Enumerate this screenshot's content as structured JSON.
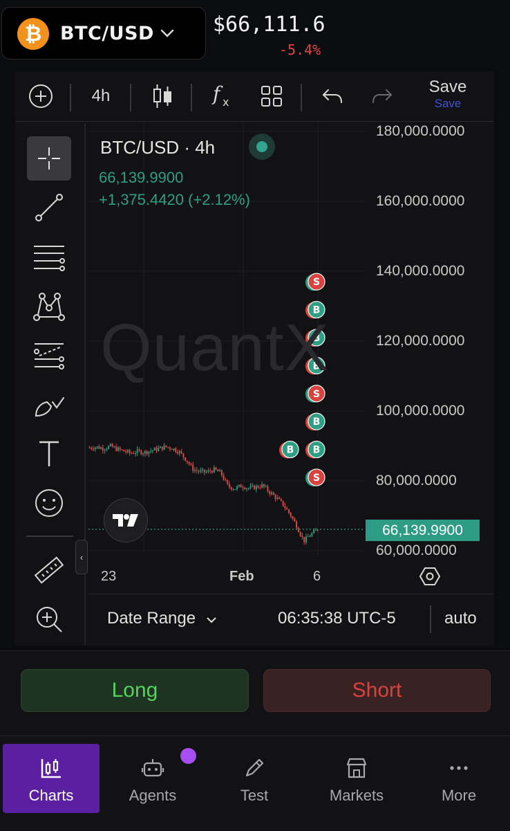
{
  "header": {
    "pair_icon": "bitcoin-icon",
    "pair": "BTC/USD",
    "price": "$66,111.6",
    "change": "-5.4%",
    "colors": {
      "positive": "#2f9f84",
      "negative": "#e04848",
      "btc": "#f2921b"
    }
  },
  "toolbar": {
    "add_icon": "plus-circle-icon",
    "interval": "4h",
    "candles_icon": "candlestick-icon",
    "indicators_icon": "fx-icon",
    "layouts_icon": "grid-icon",
    "undo_icon": "undo-icon",
    "redo_icon": "redo-icon",
    "save_label": "Save",
    "save_sub": "Save"
  },
  "drawing_tools": [
    "crosshair-icon",
    "trend-line-icon",
    "horizontal-lines-icon",
    "pattern-icon",
    "fib-icon",
    "brush-icon",
    "text-icon",
    "emoji-icon",
    "ruler-icon",
    "zoom-in-icon"
  ],
  "legend": {
    "title": "BTC/USD · 4h",
    "value": "66,139.9900",
    "change": "+1,375.4420 (+2.12%)"
  },
  "watermark": "QuantX",
  "chart_data": {
    "type": "candlestick",
    "y_ticks": [
      "180,000.0000",
      "160,000.0000",
      "140,000.0000",
      "120,000.0000",
      "100,000.0000",
      "80,000.0000",
      "60,000.0000"
    ],
    "x_ticks": [
      "23",
      "Feb",
      "6"
    ],
    "ylim": [
      60000,
      180000
    ],
    "last_price_label": "66,139.9900",
    "last_price": 66139.99,
    "trend_close": [
      89500,
      89700,
      89300,
      89900,
      89100,
      88500,
      87900,
      88400,
      88200,
      88700,
      89200,
      89800,
      89300,
      88300,
      86000,
      83300,
      82600,
      82500,
      83200,
      82300,
      78500,
      77800,
      78600,
      77900,
      78200,
      78700,
      76900,
      75200,
      73200,
      70500,
      67000,
      62800,
      64600,
      66140
    ],
    "trade_markers": [
      {
        "side": "S",
        "price": 137000
      },
      {
        "side": "B",
        "price": 129000
      },
      {
        "side": "B",
        "price": 121000
      },
      {
        "side": "B",
        "price": 113000
      },
      {
        "side": "S",
        "price": 105000
      },
      {
        "side": "B",
        "price": 97000
      },
      {
        "side": "B",
        "price": 89000
      },
      {
        "side": "B",
        "price": 89000
      },
      {
        "side": "S",
        "price": 81000
      }
    ]
  },
  "bottom_bar": {
    "date_range": "Date Range",
    "time": "06:35:38 UTC-5",
    "scale": "auto"
  },
  "trade": {
    "long": "Long",
    "short": "Short"
  },
  "nav": {
    "items": [
      {
        "label": "Charts",
        "icon": "chart-icon"
      },
      {
        "label": "Agents",
        "icon": "robot-icon"
      },
      {
        "label": "Test",
        "icon": "pencil-icon"
      },
      {
        "label": "Markets",
        "icon": "store-icon"
      },
      {
        "label": "More",
        "icon": "more-dots-icon"
      }
    ]
  }
}
